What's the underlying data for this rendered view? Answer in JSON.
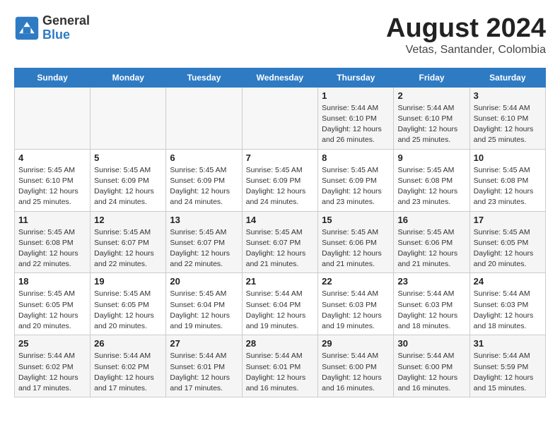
{
  "header": {
    "logo_line1": "General",
    "logo_line2": "Blue",
    "month_title": "August 2024",
    "location": "Vetas, Santander, Colombia"
  },
  "weekdays": [
    "Sunday",
    "Monday",
    "Tuesday",
    "Wednesday",
    "Thursday",
    "Friday",
    "Saturday"
  ],
  "weeks": [
    [
      {
        "day": "",
        "info": ""
      },
      {
        "day": "",
        "info": ""
      },
      {
        "day": "",
        "info": ""
      },
      {
        "day": "",
        "info": ""
      },
      {
        "day": "1",
        "info": "Sunrise: 5:44 AM\nSunset: 6:10 PM\nDaylight: 12 hours\nand 26 minutes."
      },
      {
        "day": "2",
        "info": "Sunrise: 5:44 AM\nSunset: 6:10 PM\nDaylight: 12 hours\nand 25 minutes."
      },
      {
        "day": "3",
        "info": "Sunrise: 5:44 AM\nSunset: 6:10 PM\nDaylight: 12 hours\nand 25 minutes."
      }
    ],
    [
      {
        "day": "4",
        "info": "Sunrise: 5:45 AM\nSunset: 6:10 PM\nDaylight: 12 hours\nand 25 minutes."
      },
      {
        "day": "5",
        "info": "Sunrise: 5:45 AM\nSunset: 6:09 PM\nDaylight: 12 hours\nand 24 minutes."
      },
      {
        "day": "6",
        "info": "Sunrise: 5:45 AM\nSunset: 6:09 PM\nDaylight: 12 hours\nand 24 minutes."
      },
      {
        "day": "7",
        "info": "Sunrise: 5:45 AM\nSunset: 6:09 PM\nDaylight: 12 hours\nand 24 minutes."
      },
      {
        "day": "8",
        "info": "Sunrise: 5:45 AM\nSunset: 6:09 PM\nDaylight: 12 hours\nand 23 minutes."
      },
      {
        "day": "9",
        "info": "Sunrise: 5:45 AM\nSunset: 6:08 PM\nDaylight: 12 hours\nand 23 minutes."
      },
      {
        "day": "10",
        "info": "Sunrise: 5:45 AM\nSunset: 6:08 PM\nDaylight: 12 hours\nand 23 minutes."
      }
    ],
    [
      {
        "day": "11",
        "info": "Sunrise: 5:45 AM\nSunset: 6:08 PM\nDaylight: 12 hours\nand 22 minutes."
      },
      {
        "day": "12",
        "info": "Sunrise: 5:45 AM\nSunset: 6:07 PM\nDaylight: 12 hours\nand 22 minutes."
      },
      {
        "day": "13",
        "info": "Sunrise: 5:45 AM\nSunset: 6:07 PM\nDaylight: 12 hours\nand 22 minutes."
      },
      {
        "day": "14",
        "info": "Sunrise: 5:45 AM\nSunset: 6:07 PM\nDaylight: 12 hours\nand 21 minutes."
      },
      {
        "day": "15",
        "info": "Sunrise: 5:45 AM\nSunset: 6:06 PM\nDaylight: 12 hours\nand 21 minutes."
      },
      {
        "day": "16",
        "info": "Sunrise: 5:45 AM\nSunset: 6:06 PM\nDaylight: 12 hours\nand 21 minutes."
      },
      {
        "day": "17",
        "info": "Sunrise: 5:45 AM\nSunset: 6:05 PM\nDaylight: 12 hours\nand 20 minutes."
      }
    ],
    [
      {
        "day": "18",
        "info": "Sunrise: 5:45 AM\nSunset: 6:05 PM\nDaylight: 12 hours\nand 20 minutes."
      },
      {
        "day": "19",
        "info": "Sunrise: 5:45 AM\nSunset: 6:05 PM\nDaylight: 12 hours\nand 20 minutes."
      },
      {
        "day": "20",
        "info": "Sunrise: 5:45 AM\nSunset: 6:04 PM\nDaylight: 12 hours\nand 19 minutes."
      },
      {
        "day": "21",
        "info": "Sunrise: 5:44 AM\nSunset: 6:04 PM\nDaylight: 12 hours\nand 19 minutes."
      },
      {
        "day": "22",
        "info": "Sunrise: 5:44 AM\nSunset: 6:03 PM\nDaylight: 12 hours\nand 19 minutes."
      },
      {
        "day": "23",
        "info": "Sunrise: 5:44 AM\nSunset: 6:03 PM\nDaylight: 12 hours\nand 18 minutes."
      },
      {
        "day": "24",
        "info": "Sunrise: 5:44 AM\nSunset: 6:03 PM\nDaylight: 12 hours\nand 18 minutes."
      }
    ],
    [
      {
        "day": "25",
        "info": "Sunrise: 5:44 AM\nSunset: 6:02 PM\nDaylight: 12 hours\nand 17 minutes."
      },
      {
        "day": "26",
        "info": "Sunrise: 5:44 AM\nSunset: 6:02 PM\nDaylight: 12 hours\nand 17 minutes."
      },
      {
        "day": "27",
        "info": "Sunrise: 5:44 AM\nSunset: 6:01 PM\nDaylight: 12 hours\nand 17 minutes."
      },
      {
        "day": "28",
        "info": "Sunrise: 5:44 AM\nSunset: 6:01 PM\nDaylight: 12 hours\nand 16 minutes."
      },
      {
        "day": "29",
        "info": "Sunrise: 5:44 AM\nSunset: 6:00 PM\nDaylight: 12 hours\nand 16 minutes."
      },
      {
        "day": "30",
        "info": "Sunrise: 5:44 AM\nSunset: 6:00 PM\nDaylight: 12 hours\nand 16 minutes."
      },
      {
        "day": "31",
        "info": "Sunrise: 5:44 AM\nSunset: 5:59 PM\nDaylight: 12 hours\nand 15 minutes."
      }
    ]
  ]
}
